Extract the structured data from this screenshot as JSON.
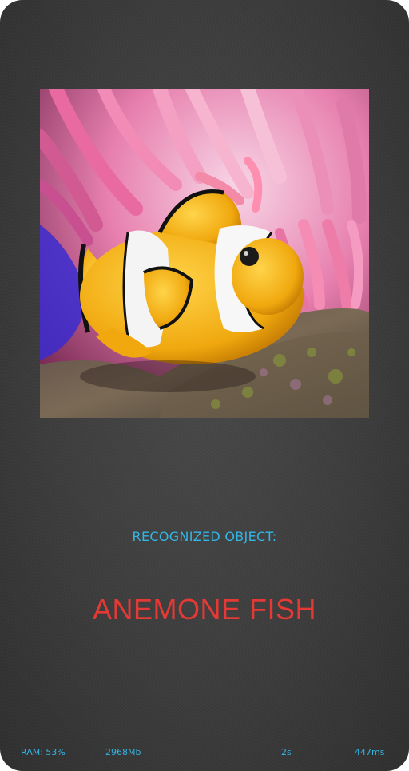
{
  "image": {
    "subject": "anemone-fish-photo"
  },
  "recognition": {
    "label": "RECOGNIZED OBJECT:",
    "result": "ANEMONE FISH",
    "label_color": "#33b5e5",
    "result_color": "#e53935"
  },
  "stats": {
    "ram": "RAM: 53%",
    "memory": "2968Mb",
    "time": "2s",
    "latency": "447ms"
  },
  "colors": {
    "background": "#3d3d3d",
    "accent": "#33b5e5"
  }
}
